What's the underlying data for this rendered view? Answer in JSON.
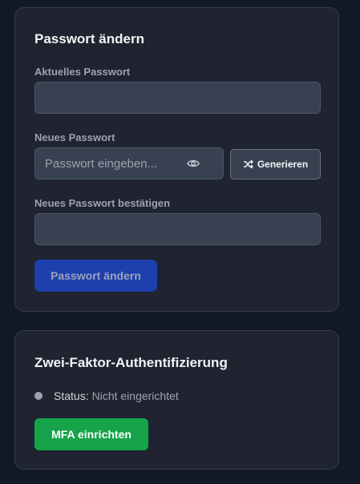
{
  "password_card": {
    "title": "Passwort ändern",
    "current_password_label": "Aktuelles Passwort",
    "current_password_value": "",
    "new_password_label": "Neues Passwort",
    "new_password_placeholder": "Passwort eingeben...",
    "new_password_value": "",
    "generate_label": "Generieren",
    "confirm_password_label": "Neues Passwort bestätigen",
    "confirm_password_value": "",
    "submit_label": "Passwort ändern"
  },
  "mfa_card": {
    "title": "Zwei-Faktor-Authentifizierung",
    "status_label": "Status:",
    "status_value": "Nicht eingerichtet",
    "setup_label": "MFA einrichten"
  },
  "icons": {
    "visibility_toggle": "eye-icon",
    "generate": "shuffle-icon"
  },
  "colors": {
    "background": "#111827",
    "card": "#1f2430",
    "primary": "#1e40af",
    "success": "#16a34a",
    "status_inactive": "#9ca3af"
  }
}
